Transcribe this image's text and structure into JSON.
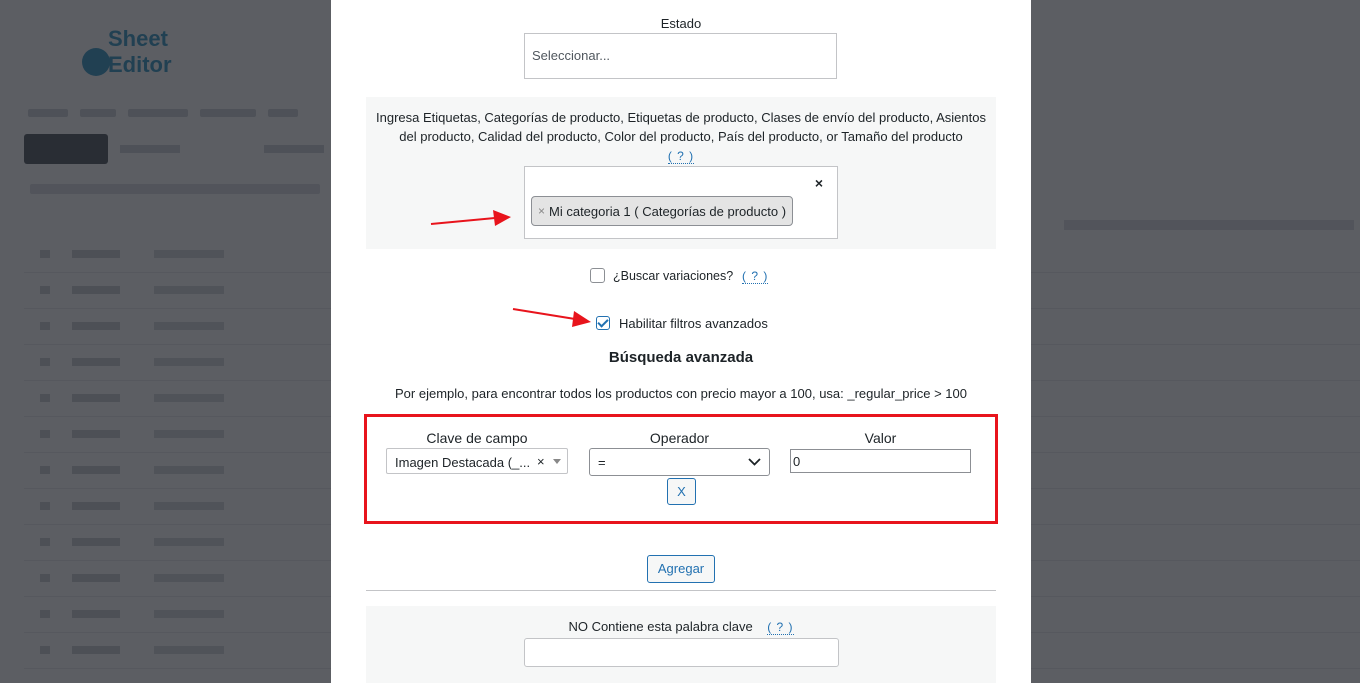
{
  "background_app": {
    "logo_text": "Sheet Editor"
  },
  "modal": {
    "estado": {
      "label": "Estado",
      "placeholder": "Seleccionar..."
    },
    "taxonomy": {
      "description": "Ingresa Etiquetas, Categorías de producto, Etiquetas de producto, Clases de envío del producto, Asientos del producto, Calidad del producto, Color del producto, País del producto, or Tamaño del producto",
      "help": "( ? )",
      "clear_all": "×",
      "selected_tags": [
        {
          "remove": "×",
          "label": "Mi categoria 1 ( Categorías de producto )"
        }
      ]
    },
    "search_variations": {
      "label": "¿Buscar variaciones?",
      "checked": false,
      "help": "( ? )"
    },
    "advanced_filters": {
      "label": "Habilitar filtros avanzados",
      "checked": true
    },
    "advanced_search": {
      "title": "Búsqueda avanzada",
      "example": "Por ejemplo, para encontrar todos los productos con precio mayor a 100, usa: _regular_price > 100",
      "columns": {
        "field_key": "Clave de campo",
        "operator": "Operador",
        "value": "Valor"
      },
      "row": {
        "field_key_value": "Imagen Destacada (_...",
        "field_key_clear": "×",
        "operator_value": "=",
        "value": "0",
        "remove_button": "X"
      },
      "add_button": "Agregar"
    },
    "not_contains": {
      "label": "NO Contiene esta palabra clave",
      "help": "( ? )",
      "value": ""
    }
  },
  "annotations": {
    "arrow_color": "#e8141c",
    "highlight_color": "#e8141c"
  }
}
